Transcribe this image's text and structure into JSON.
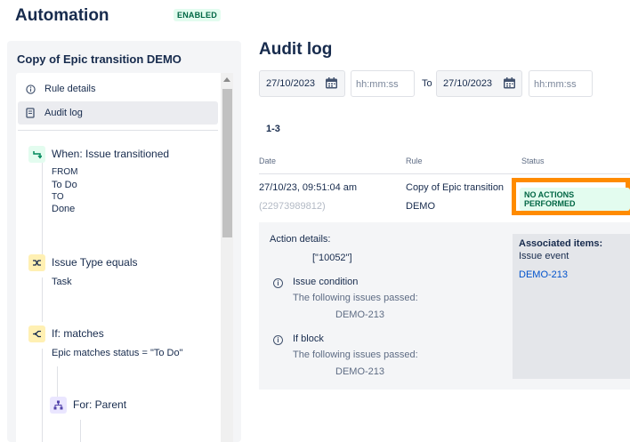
{
  "header": {
    "title": "Automation",
    "status_badge": "ENABLED"
  },
  "sidebar": {
    "rule_name": "Copy of Epic transition DEMO",
    "menu": [
      {
        "label": "Rule details",
        "icon": "info-icon"
      },
      {
        "label": "Audit log",
        "icon": "document-icon",
        "active": true
      }
    ],
    "steps": [
      {
        "title": "When: Issue transitioned",
        "icon": "transition-icon",
        "details": [
          "FROM",
          "To Do",
          "TO",
          "Done"
        ]
      },
      {
        "title": "Issue Type equals",
        "icon": "shuffle-icon",
        "details": [
          "Task"
        ]
      },
      {
        "title": "If: matches",
        "icon": "branch-icon",
        "details": [
          "Epic matches status = \"To Do\""
        ]
      },
      {
        "title": "For: Parent",
        "icon": "hierarchy-icon",
        "details": []
      }
    ]
  },
  "main": {
    "title": "Audit log",
    "filter": {
      "from_date": "27/10/2023",
      "from_time_placeholder": "hh:mm:ss",
      "to_label": "To",
      "to_date": "27/10/2023",
      "to_time_placeholder": "hh:mm:ss"
    },
    "result_count": "1-3",
    "table": {
      "headers": {
        "date": "Date",
        "rule": "Rule",
        "status": "Status"
      },
      "rows": [
        {
          "date": "27/10/23, 09:51:04 am",
          "id": "(22973989812)",
          "rule_line1": "Copy of Epic transition",
          "rule_line2": "DEMO",
          "status": "NO ACTIONS PERFORMED"
        }
      ]
    },
    "details": {
      "action_details_label": "Action details:",
      "action_value": "[\"10052\"]",
      "items": [
        {
          "title": "Issue condition",
          "desc": "The following issues passed:",
          "issue": "DEMO-213"
        },
        {
          "title": "If block",
          "desc": "The following issues passed:",
          "issue": "DEMO-213"
        }
      ],
      "associated": {
        "title": "Associated items:",
        "subtitle": "Issue event",
        "link": "DEMO-213"
      }
    }
  },
  "colors": {
    "highlight": "#ff8b00",
    "success_text": "#006644",
    "success_bg": "#e3fcef",
    "link": "#0052cc"
  }
}
